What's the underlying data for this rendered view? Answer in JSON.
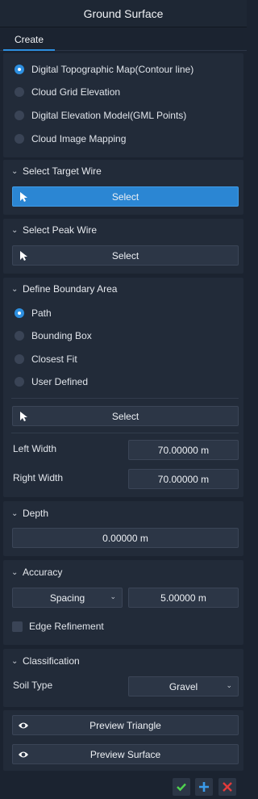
{
  "window": {
    "title": "Ground Surface"
  },
  "tabs": [
    {
      "label": "Create"
    }
  ],
  "source_options": {
    "selected": 0,
    "items": [
      {
        "label": "Digital Topographic Map(Contour line)"
      },
      {
        "label": "Cloud Grid Elevation"
      },
      {
        "label": "Digital Elevation Model(GML Points)"
      },
      {
        "label": "Cloud Image Mapping"
      }
    ]
  },
  "target_wire": {
    "title": "Select Target Wire",
    "button": "Select"
  },
  "peak_wire": {
    "title": "Select Peak Wire",
    "button": "Select"
  },
  "boundary": {
    "title": "Define Boundary Area",
    "selected": 0,
    "options": [
      {
        "label": "Path"
      },
      {
        "label": "Bounding Box"
      },
      {
        "label": "Closest Fit"
      },
      {
        "label": "User Defined"
      }
    ],
    "button": "Select",
    "left_width_label": "Left Width",
    "left_width_value": "70.00000 m",
    "right_width_label": "Right Width",
    "right_width_value": "70.00000 m"
  },
  "depth": {
    "title": "Depth",
    "value": "0.00000 m"
  },
  "accuracy": {
    "title": "Accuracy",
    "mode": "Spacing",
    "value": "5.00000 m",
    "edge_refinement_label": "Edge Refinement",
    "edge_refinement_checked": false
  },
  "classification": {
    "title": "Classification",
    "soil_type_label": "Soil Type",
    "soil_type_value": "Gravel"
  },
  "preview": {
    "triangle_button": "Preview Triangle",
    "surface_button": "Preview Surface"
  },
  "footer": {
    "icons": [
      "check-icon",
      "plus-icon",
      "close-icon"
    ]
  },
  "colors": {
    "accent": "#2d8fe0",
    "ok": "#4fd34f",
    "cancel": "#e23b3b"
  }
}
